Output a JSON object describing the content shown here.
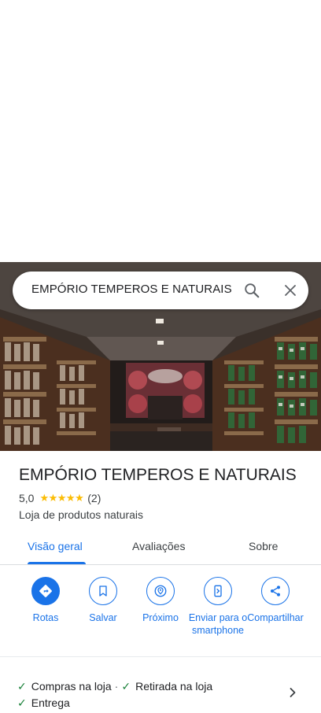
{
  "search": {
    "query": "EMPÓRIO TEMPEROS E NATURAIS",
    "search_icon": "search-icon",
    "close_icon": "close-icon"
  },
  "place": {
    "title": "EMPÓRIO TEMPEROS E NATURAIS",
    "rating": "5,0",
    "stars": "★★★★★",
    "star_value": 5,
    "review_count": "(2)",
    "category": "Loja de produtos naturais"
  },
  "tabs": [
    {
      "label": "Visão geral",
      "active": true
    },
    {
      "label": "Avaliações",
      "active": false
    },
    {
      "label": "Sobre",
      "active": false
    }
  ],
  "actions": [
    {
      "label": "Rotas",
      "icon": "directions-icon"
    },
    {
      "label": "Salvar",
      "icon": "bookmark-icon"
    },
    {
      "label": "Próximo",
      "icon": "nearby-icon"
    },
    {
      "label": "Enviar para o smartphone",
      "icon": "send-to-phone-icon"
    },
    {
      "label": "Compartilhar",
      "icon": "share-icon"
    }
  ],
  "features": {
    "items": [
      "Compras na loja",
      "Retirada na loja",
      "Entrega"
    ],
    "separator": "·",
    "check_icon": "check-icon",
    "chevron_icon": "chevron-right-icon"
  },
  "colors": {
    "accent": "#1a73e8",
    "star": "#fbbc04",
    "check": "#188038"
  }
}
